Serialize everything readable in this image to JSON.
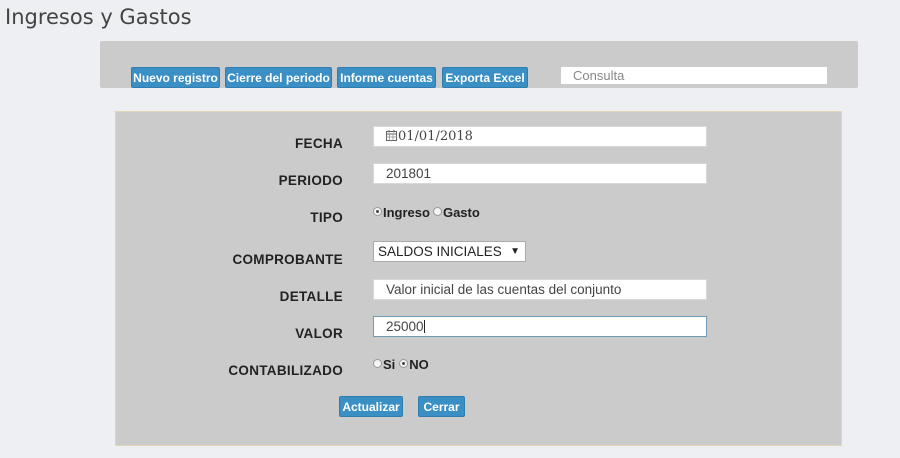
{
  "page": {
    "title": "Ingresos y Gastos"
  },
  "toolbar": {
    "buttons": [
      "Nuevo registro",
      "Cierre del periodo",
      "Informe cuentas",
      "Exporta Excel"
    ],
    "search_placeholder": "Consulta"
  },
  "form": {
    "labels": {
      "fecha": "FECHA",
      "periodo": "PERIODO",
      "tipo": "TIPO",
      "comprobante": "COMPROBANTE",
      "detalle": "DETALLE",
      "valor": "VALOR",
      "contabilizado": "CONTABILIZADO"
    },
    "values": {
      "fecha": "01/01/2018",
      "periodo": "201801",
      "comprobante": "SALDOS INICIALES",
      "detalle": "Valor inicial de las cuentas del conjunto",
      "valor": "25000"
    },
    "tipo_options": [
      "Ingreso",
      "Gasto"
    ],
    "tipo_selected": "Ingreso",
    "contabilizado_options": [
      "Si",
      "NO"
    ],
    "contabilizado_selected": "NO",
    "actions": {
      "actualizar": "Actualizar",
      "cerrar": "Cerrar"
    }
  },
  "icons": {
    "date": "calendar-icon",
    "select": "dropdown-arrow-icon"
  },
  "colors": {
    "button": "#3a8fc5",
    "panel": "#cbcbcb",
    "background": "#edeff2"
  }
}
